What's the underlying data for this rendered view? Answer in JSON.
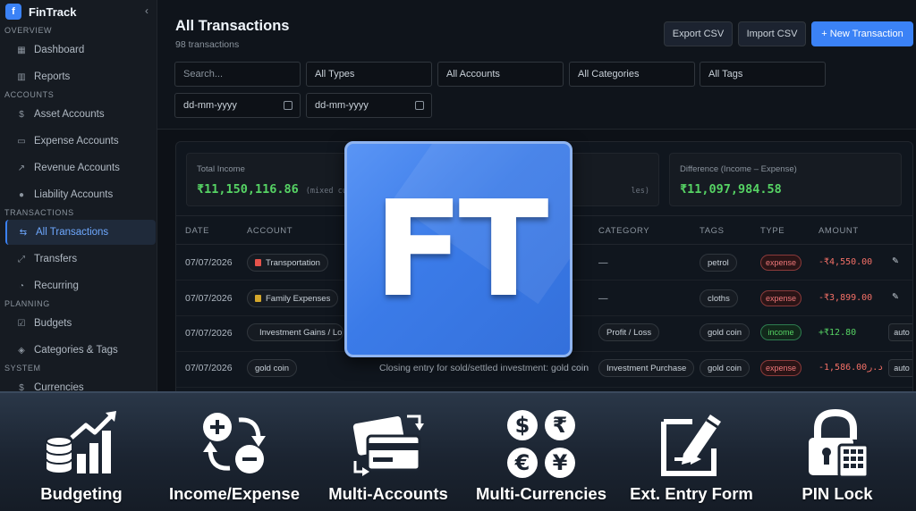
{
  "app": {
    "name": "FinTrack",
    "logo_letter": "f",
    "collapse_icon": "chevron-left-icon"
  },
  "sidebar": {
    "sections": [
      {
        "label": "OVERVIEW"
      },
      {
        "label": "ACCOUNTS"
      },
      {
        "label": "TRANSACTIONS"
      },
      {
        "label": "PLANNING"
      },
      {
        "label": "SYSTEM"
      }
    ],
    "items": [
      {
        "label": "Dashboard",
        "icon": "grid-icon",
        "glyph": "▦"
      },
      {
        "label": "Reports",
        "icon": "bar-chart-icon",
        "glyph": "▥"
      },
      {
        "label": "Asset Accounts",
        "icon": "dollar-icon",
        "glyph": "$"
      },
      {
        "label": "Expense Accounts",
        "icon": "card-icon",
        "glyph": "▭"
      },
      {
        "label": "Revenue Accounts",
        "icon": "trend-icon",
        "glyph": "↗"
      },
      {
        "label": "Liability Accounts",
        "icon": "info-icon",
        "glyph": "●"
      },
      {
        "label": "All Transactions",
        "icon": "swap-icon",
        "glyph": "⇆",
        "active": true
      },
      {
        "label": "Transfers",
        "icon": "transfer-icon",
        "glyph": "⤢"
      },
      {
        "label": "Recurring",
        "icon": "recurring-icon",
        "glyph": "◔"
      },
      {
        "label": "Budgets",
        "icon": "budget-icon",
        "glyph": "☑"
      },
      {
        "label": "Categories & Tags",
        "icon": "tag-icon",
        "glyph": "◈"
      },
      {
        "label": "Currencies",
        "icon": "dollar-icon",
        "glyph": "$"
      }
    ]
  },
  "header": {
    "title": "All Transactions",
    "subtitle": "98 transactions",
    "export_label": "Export CSV",
    "import_label": "Import CSV",
    "new_label": "+  New Transaction"
  },
  "filters": {
    "search_placeholder": "Search...",
    "type": "All Types",
    "account": "All Accounts",
    "category": "All Categories",
    "tags": "All Tags",
    "date_from": "dd-mm-yyyy",
    "date_to": "dd-mm-yyyy"
  },
  "summary": {
    "income_label": "Total Income",
    "income_value": "₹11,150,116.86",
    "income_note": "(mixed cur",
    "middle_note": "les)",
    "diff_label": "Difference (Income – Expense)",
    "diff_value": "₹11,097,984.58"
  },
  "table": {
    "headers": {
      "date": "DATE",
      "account": "ACCOUNT",
      "category": "CATEGORY",
      "tags": "TAGS",
      "type": "TYPE",
      "amount": "AMOUNT"
    },
    "rows": [
      {
        "date": "07/07/2026",
        "account": "Transportation",
        "account_color": "#e5534b",
        "description": "",
        "category": "—",
        "tag": "petrol",
        "type": "expense",
        "amount": "-₹4,550.00",
        "action": "pencil"
      },
      {
        "date": "07/07/2026",
        "account": "Family Expenses",
        "account_color": "#d4a72c",
        "description": "",
        "category": "—",
        "tag": "cloths",
        "type": "expense",
        "amount": "-₹3,899.00",
        "action": "pencil"
      },
      {
        "date": "07/07/2026",
        "account": "Investment Gains / Los",
        "account_color": "#6cb6ff",
        "description": "",
        "category": "Profit / Loss",
        "tag": "gold coin",
        "type": "income",
        "amount": "+₹12.80",
        "action": "auto"
      },
      {
        "date": "07/07/2026",
        "account": "gold coin",
        "account_color": "",
        "description": "Closing entry for sold/settled investment: gold coin",
        "category": "Investment Purchase",
        "tag": "gold coin",
        "type": "expense",
        "amount": "-1,586.00د.ر",
        "action": "auto"
      }
    ]
  },
  "overlay": {
    "logo_text": "FT"
  },
  "features": [
    {
      "label": "Budgeting",
      "icon": "budget-growth-icon"
    },
    {
      "label": "Income/Expense",
      "icon": "plus-minus-icon"
    },
    {
      "label": "Multi-Accounts",
      "icon": "credit-cards-icon"
    },
    {
      "label": "Multi-Currencies",
      "icon": "currency-coins-icon"
    },
    {
      "label": "Ext. Entry Form",
      "icon": "edit-form-icon"
    },
    {
      "label": "PIN Lock",
      "icon": "padlock-keypad-icon"
    }
  ]
}
